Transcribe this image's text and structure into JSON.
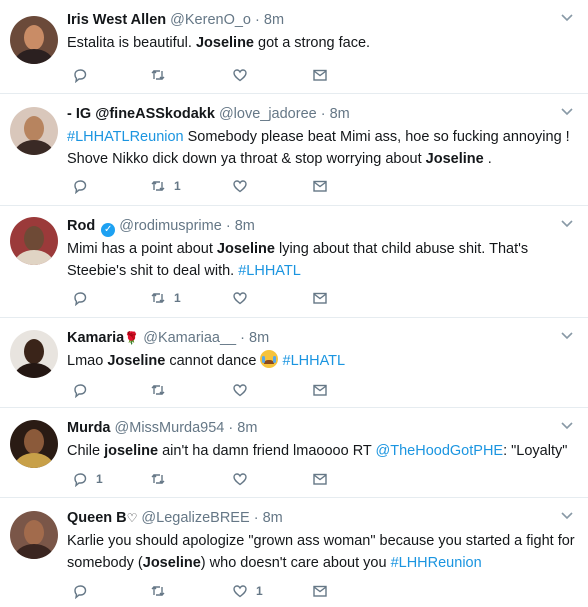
{
  "tweets": [
    {
      "name": "Iris West Allen",
      "handle": "@KerenO_o",
      "dot": "·",
      "time": "8m",
      "segments": [
        {
          "t": "Estalita is beautiful. "
        },
        {
          "t": "Joseline",
          "b": true
        },
        {
          "t": " got a strong face."
        }
      ],
      "counts": {
        "reply": "",
        "retweet": "",
        "like": ""
      }
    },
    {
      "name": "- IG @fineASSkodakk",
      "handle": "@love_jadoree",
      "dot": "·",
      "time": "8m",
      "segments": [
        {
          "t": "#LHHATLReunion",
          "link": true
        },
        {
          "t": " Somebody please beat Mimi ass, hoe so fucking annoying ! Shove Nikko dick down ya throat & stop worrying about "
        },
        {
          "t": "Joseline",
          "b": true
        },
        {
          "t": " ."
        }
      ],
      "counts": {
        "reply": "",
        "retweet": "1",
        "like": ""
      }
    },
    {
      "name": "Rod",
      "handle": "@rodimusprime",
      "dot": "·",
      "time": "8m",
      "verified_glyph": "✓",
      "segments": [
        {
          "t": "Mimi has a point about "
        },
        {
          "t": "Joseline",
          "b": true
        },
        {
          "t": " lying about that child abuse shit. That's Steebie's shit to deal with. "
        },
        {
          "t": "#LHHATL",
          "link": true
        }
      ],
      "counts": {
        "reply": "",
        "retweet": "1",
        "like": ""
      }
    },
    {
      "name": "Kamaria",
      "name_emoji": "🌹",
      "handle": "@Kamariaa__",
      "dot": "·",
      "time": "8m",
      "segments": [
        {
          "t": "Lmao "
        },
        {
          "t": "Joseline",
          "b": true
        },
        {
          "t": " cannot dance "
        },
        {
          "emoji": "crying-face"
        },
        {
          "t": " "
        },
        {
          "t": "#LHHATL",
          "link": true
        }
      ],
      "counts": {
        "reply": "",
        "retweet": "",
        "like": ""
      }
    },
    {
      "name": "Murda",
      "handle": "@MissMurda954",
      "dot": "·",
      "time": "8m",
      "segments": [
        {
          "t": "Chile "
        },
        {
          "t": "joseline",
          "b": true
        },
        {
          "t": " ain't ha damn friend lmaoooo RT "
        },
        {
          "t": "@TheHoodGotPHE",
          "link": true
        },
        {
          "t": ": \"Loyalty\""
        }
      ],
      "counts": {
        "reply": "1",
        "retweet": "",
        "like": ""
      }
    },
    {
      "name": "Queen B",
      "name_emoji": "♡",
      "handle": "@LegalizeBREE",
      "dot": "·",
      "time": "8m",
      "segments": [
        {
          "t": "Karlie you should apologize \"grown ass woman\" because you started a fight for somebody ("
        },
        {
          "t": "Joseline",
          "b": true
        },
        {
          "t": ") who doesn't care about you "
        },
        {
          "t": "#LHHReunion",
          "link": true
        }
      ],
      "counts": {
        "reply": "",
        "retweet": "",
        "like": "1"
      }
    }
  ],
  "colors": {
    "accent": "#1da1f2",
    "link": "#1b95e0",
    "muted": "#657786",
    "divider": "#e6ecf0",
    "icon": "#657786"
  },
  "avatars": [
    {
      "bg": "#6b4a3a",
      "face": "#c98c66",
      "body": "#2b2020"
    },
    {
      "bg": "#d9c7bb",
      "face": "#b7845f",
      "body": "#3a2a25"
    },
    {
      "bg": "#9b3a3a",
      "face": "#6e4a36",
      "body": "#e0d4c4"
    },
    {
      "bg": "#e8e4df",
      "face": "#3a2419",
      "body": "#241713"
    },
    {
      "bg": "#2a1b14",
      "face": "#8b5a3a",
      "body": "#c8a048"
    },
    {
      "bg": "#7a5648",
      "face": "#a26b4c",
      "body": "#3a2520"
    }
  ]
}
